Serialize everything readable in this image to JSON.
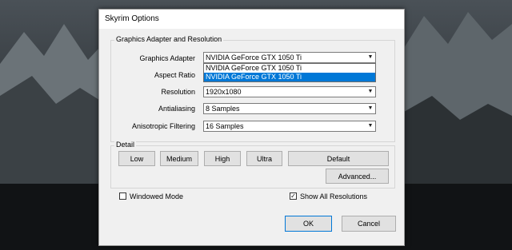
{
  "dialog": {
    "title": "Skyrim Options"
  },
  "graphics": {
    "group_label": "Graphics Adapter and Resolution",
    "adapter_label": "Graphics Adapter",
    "adapter_value": "NVIDIA GeForce GTX 1050 Ti",
    "dropdown_items": [
      "NVIDIA GeForce GTX 1050 Ti",
      "NVIDIA GeForce GTX 1050 Ti"
    ],
    "aspect_label": "Aspect Ratio",
    "resolution_label": "Resolution",
    "resolution_value": "1920x1080",
    "antialiasing_label": "Antialiasing",
    "antialiasing_value": "8 Samples",
    "anisotropic_label": "Anisotropic Filtering",
    "anisotropic_value": "16 Samples"
  },
  "detail": {
    "group_label": "Detail",
    "low": "Low",
    "medium": "Medium",
    "high": "High",
    "ultra": "Ultra",
    "default": "Default",
    "advanced": "Advanced..."
  },
  "options": {
    "windowed_label": "Windowed Mode",
    "windowed_checked": false,
    "show_all_label": "Show All Resolutions",
    "show_all_checked": true
  },
  "buttons": {
    "ok": "OK",
    "cancel": "Cancel"
  },
  "icons": {
    "dropdown_arrow": "chevron-down-icon",
    "check": "checkmark-icon"
  },
  "colors": {
    "selection": "#0078d7",
    "dialog_bg": "#f0f0f0"
  }
}
